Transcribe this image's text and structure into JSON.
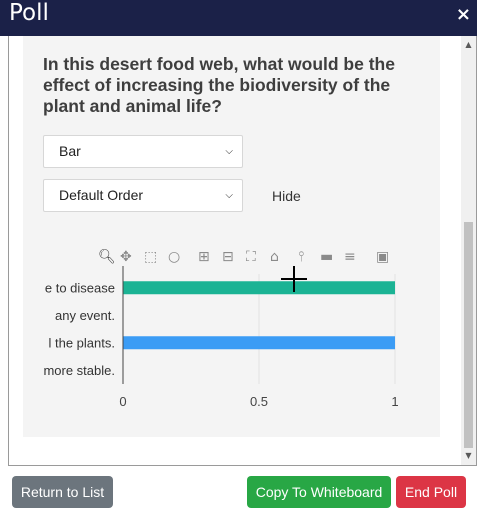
{
  "header": {
    "title": "Poll",
    "close_symbol": "×"
  },
  "question": "In this desert food web, what would be the effect of increasing the biodiversity of the plant and animal life?",
  "chart_type_select": {
    "value": "Bar"
  },
  "order_select": {
    "value": "Default Order"
  },
  "hide_label": "Hide",
  "chart_data": {
    "type": "bar",
    "orientation": "horizontal",
    "categories": [
      "e to disease",
      "any event.",
      "l the plants.",
      "more stable."
    ],
    "values": [
      1,
      0,
      1,
      0
    ],
    "bar_colors": [
      "#1bb394",
      "#1bb394",
      "#3b9cf5",
      "#3b9cf5"
    ],
    "xlim": [
      0,
      1
    ],
    "xticks": [
      "0",
      "0.5",
      "1"
    ],
    "grid": true
  },
  "footer": {
    "return_label": "Return to List",
    "copy_label": "Copy To Whiteboard",
    "end_label": "End Poll"
  },
  "colors": {
    "header_bg": "#1b2148",
    "teal_bar": "#1bb394",
    "blue_bar": "#3b9cf5",
    "btn_gray": "#6c757d",
    "btn_green": "#28a745",
    "btn_red": "#dc3545"
  }
}
